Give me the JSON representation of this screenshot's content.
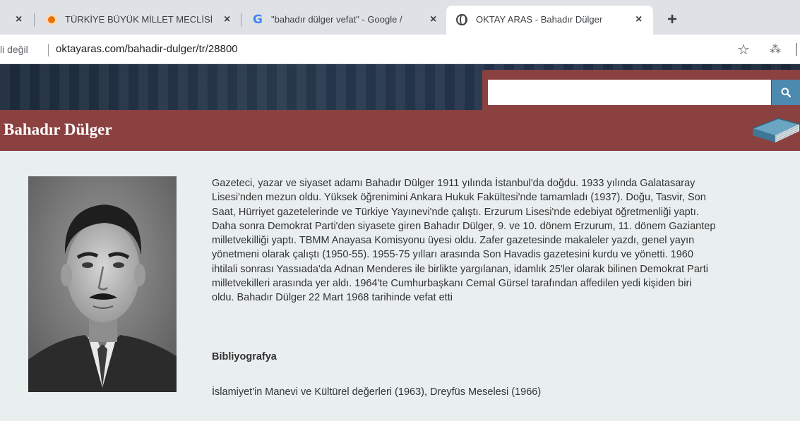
{
  "browser": {
    "tabs": [
      {
        "title": "TÜRKİYE BÜYÜK MİLLET MECLİSİ",
        "favicon": "tbmm-logo-icon",
        "active": false
      },
      {
        "title": "\"bahadır dülger vefat\" - Google /",
        "favicon": "google-g-icon",
        "active": false
      },
      {
        "title": "OKTAY ARAS - Bahadır Dülger",
        "favicon": "globe-icon",
        "active": true
      }
    ],
    "close_symbol": "×",
    "new_tab_symbol": "+",
    "security_text": "li değil",
    "url": "oktayaras.com/bahadir-dulger/tr/28800",
    "star_symbol": "☆",
    "dropbox_symbol": "⁂"
  },
  "site": {
    "search": {
      "placeholder": "",
      "value": ""
    },
    "page_title": "Bahadır Dülger",
    "bio": "Gazeteci, yazar ve siyaset adamı Bahadır Dülger 1911 yılında İstanbul'da doğdu. 1933 yılında Galatasaray\nLisesi'nden mezun oldu. Yüksek öğrenimini Ankara Hukuk Fakültesi'nde tamamladı (1937). Doğu, Tasvir, Son\nSaat, Hürriyet gazetelerinde ve Türkiye Yayınevi'nde çalıştı. Erzurum Lisesi'nde edebiyat öğretmenliği yaptı.\nDaha sonra Demokrat Parti'den siyasete giren Bahadır Dülger, 9. ve 10. dönem Erzurum, 11. dönem Gaziantep\nmilletvekilliği yaptı. TBMM Anayasa Komisyonu üyesi oldu. Zafer gazetesinde makaleler yazdı, genel yayın\nyönetmeni olarak çalıştı (1950-55). 1955-75 yılları arasında Son Havadis gazetesini kurdu ve yönetti. 1960\nihtilali sonrası Yassıada'da Adnan Menderes ile birlikte yargılanan, idamlık 25'ler olarak bilinen Demokrat Parti\nmilletvekilleri arasında yer aldı. 1964'te Cumhurbaşkanı Cemal Gürsel tarafından affedilen yedi kişiden biri\noldu. Bahadır Dülger 22 Mart 1968 tarihinde vefat etti",
    "bibliography_heading": "Bibliyografya",
    "bibliography_text": "İslamiyet'in Manevi ve Kültürel değerleri (1963), Dreyfüs Meselesi (1966)",
    "colors": {
      "title_bar": "#8a4140",
      "content_bg": "#e9eeef",
      "search_button": "#4d8ab0",
      "banner": "#22324a"
    }
  }
}
